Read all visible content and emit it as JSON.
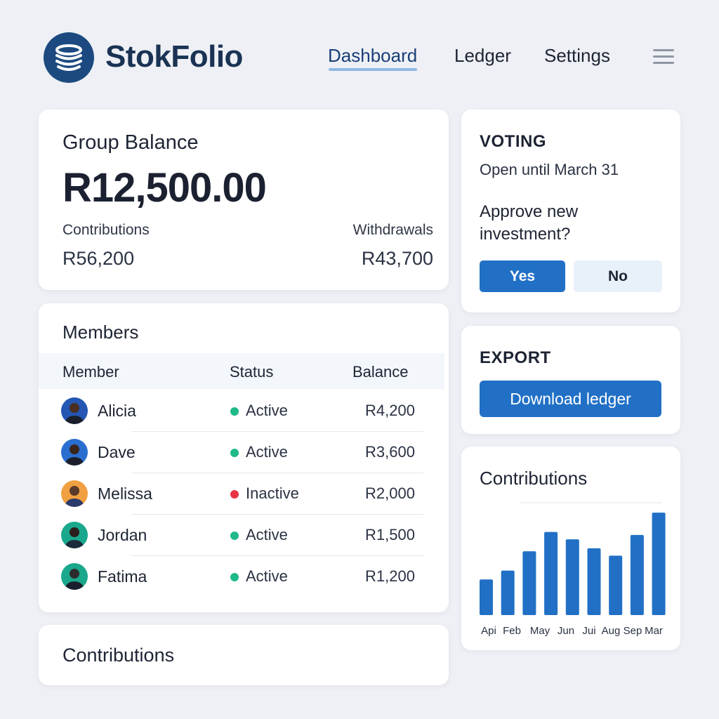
{
  "brand": {
    "name": "StokFolio",
    "logo_icon": "coin-stack-icon"
  },
  "nav": {
    "items": [
      {
        "label": "Dashboard",
        "active": true
      },
      {
        "label": "Ledger",
        "active": false
      },
      {
        "label": "Settings",
        "active": false
      }
    ],
    "menu_icon": "hamburger-menu-icon"
  },
  "balance": {
    "title": "Group Balance",
    "amount": "R12,500.00",
    "contributions_label": "Contributions",
    "contributions_value": "R56,200",
    "withdrawals_label": "Withdrawals",
    "withdrawals_value": "R43,700"
  },
  "members": {
    "title": "Members",
    "columns": [
      "Member",
      "Status",
      "Balance"
    ],
    "rows": [
      {
        "name": "Alicia",
        "status": "Active",
        "balance": "R4,200",
        "status_color": "#20b98a",
        "avatar_color": "#2456b3"
      },
      {
        "name": "Dave",
        "status": "Active",
        "balance": "R3,600",
        "status_color": "#20b98a",
        "avatar_color": "#2a6fd0"
      },
      {
        "name": "Melissa",
        "status": "Inactive",
        "balance": "R2,000",
        "status_color": "#e83445",
        "avatar_color": "#f0a040"
      },
      {
        "name": "Jordan",
        "status": "Active",
        "balance": "R1,500",
        "status_color": "#20b98a",
        "avatar_color": "#1aa88c"
      },
      {
        "name": "Fatima",
        "status": "Active",
        "balance": "R1,200",
        "status_color": "#20b98a",
        "avatar_color": "#1aa88c"
      }
    ]
  },
  "contributions_section": {
    "title": "Contributions"
  },
  "voting": {
    "heading": "VOTING",
    "open_until": "Open until March 31",
    "question": "Approve new investment?",
    "yes_label": "Yes",
    "no_label": "No"
  },
  "export": {
    "heading": "EXPORT",
    "download_label": "Download ledger"
  },
  "colors": {
    "accent": "#2170c6",
    "brand": "#1c4a80",
    "active": "#20b98a",
    "inactive": "#e83445"
  },
  "chart_data": {
    "type": "bar",
    "title": "Contributions",
    "categories": [
      "Api",
      "Feb",
      "May",
      "Jun",
      "Jui",
      "Aug",
      "Sep",
      "Mar"
    ],
    "values": [
      24,
      30,
      43,
      56,
      51,
      45,
      40,
      54,
      69
    ],
    "ylim": [
      0,
      70
    ],
    "grid": false
  }
}
